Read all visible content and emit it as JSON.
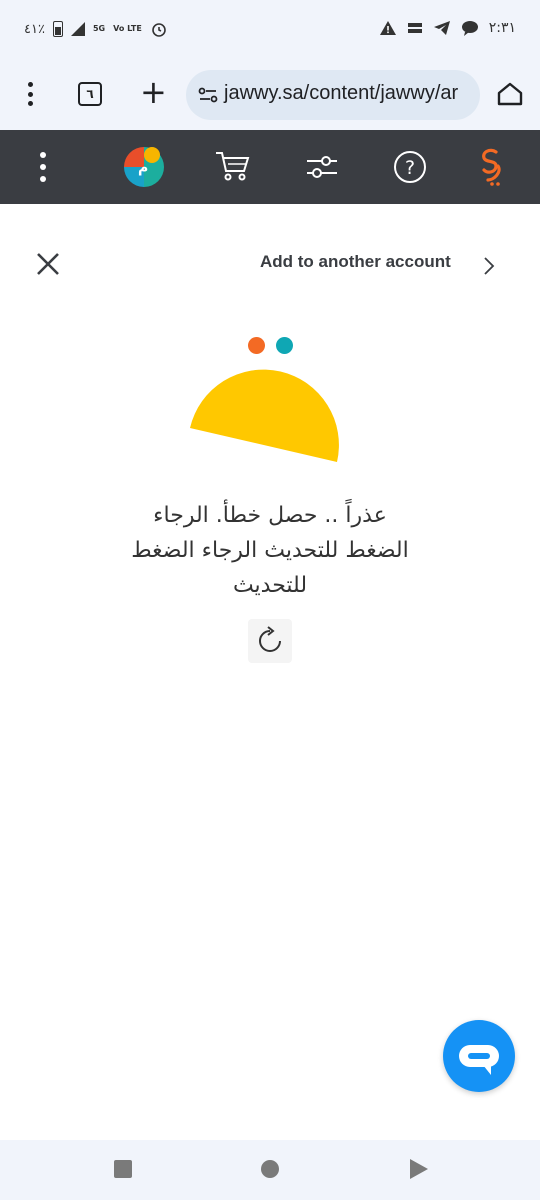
{
  "status_bar": {
    "battery_text": "٤١٪",
    "network_label": "5G",
    "volte_label": "Vo LTE",
    "time": "٢:٣١"
  },
  "browser": {
    "tab_count": "٦",
    "url": "jawwy.sa/content/jawwy/ar"
  },
  "page": {
    "add_account_label": "Add to another account",
    "error_message": "عذراً .. حصل خطأ. الرجاء الضغط للتحديث الرجاء الضغط للتحديث"
  },
  "colors": {
    "nav_bg": "#3a3d42",
    "accent_orange": "#f36a24",
    "accent_teal": "#0fa7b4",
    "smile_yellow": "#ffc800",
    "chat_blue": "#1592f5"
  },
  "icons": {
    "nav": [
      "menu-icon",
      "avatar-logo-icon",
      "cart-icon",
      "filter-icon",
      "help-icon",
      "jawwy-logo-icon"
    ]
  }
}
